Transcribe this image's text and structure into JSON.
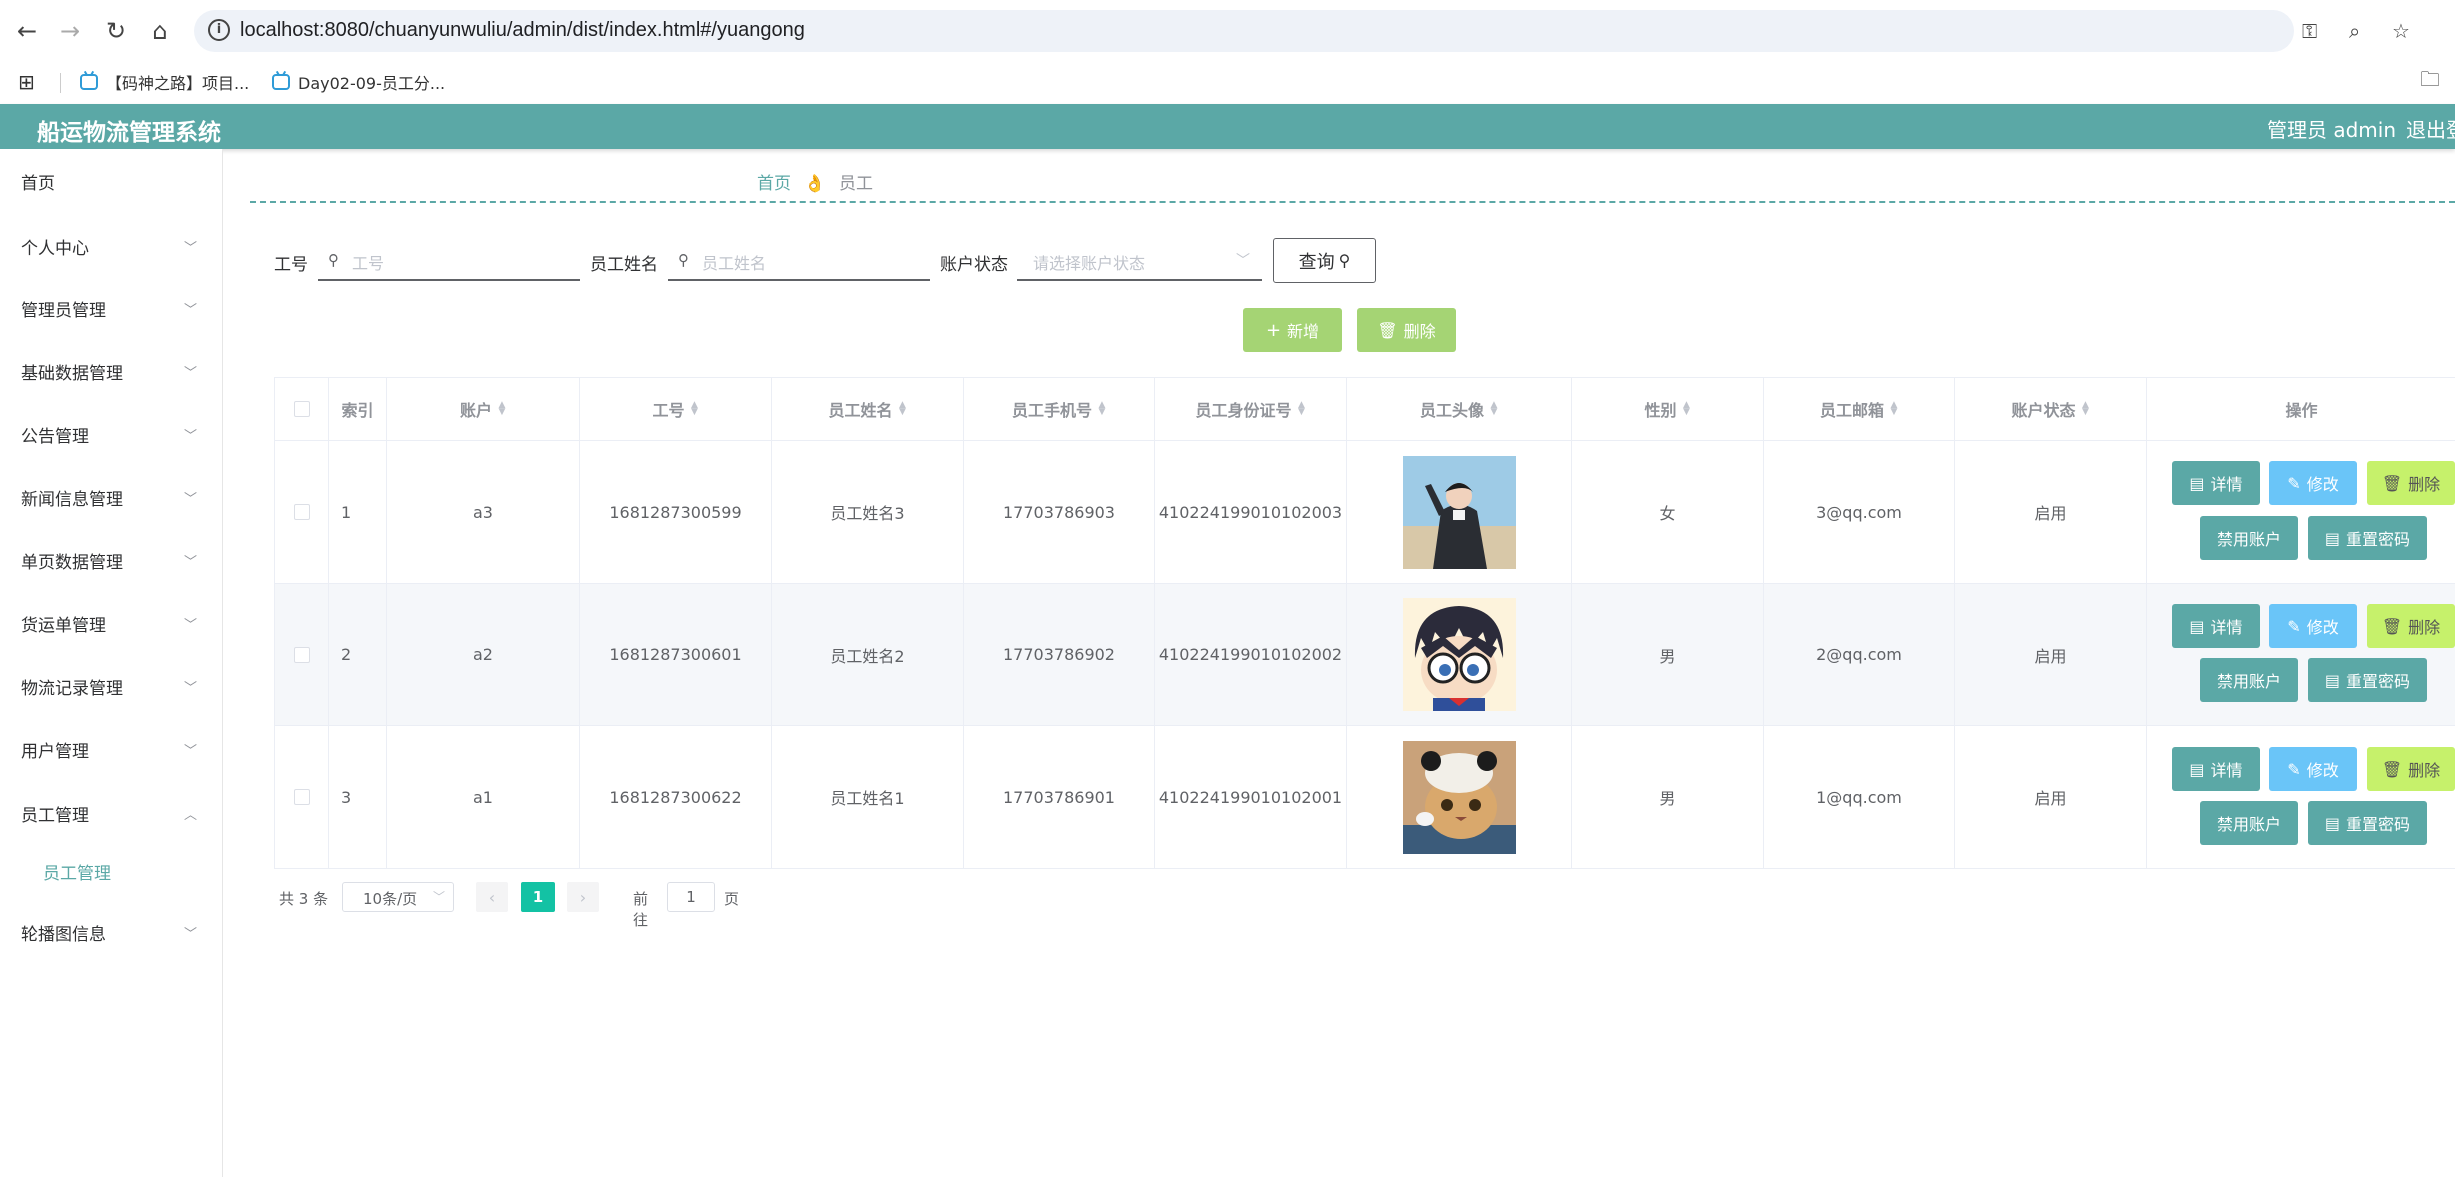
{
  "browser": {
    "url": "localhost:8080/chuanyunwuliu/admin/dist/index.html#/yuangong",
    "bookmarks": [
      "【码神之路】项目...",
      "Day02-09-员工分..."
    ]
  },
  "header": {
    "title": "船运物流管理系统",
    "admin": "管理员 admin",
    "logout": "退出登"
  },
  "sidebar": {
    "items": [
      {
        "label": "首页"
      },
      {
        "label": "个人中心"
      },
      {
        "label": "管理员管理"
      },
      {
        "label": "基础数据管理"
      },
      {
        "label": "公告管理"
      },
      {
        "label": "新闻信息管理"
      },
      {
        "label": "单页数据管理"
      },
      {
        "label": "货运单管理"
      },
      {
        "label": "物流记录管理"
      },
      {
        "label": "用户管理"
      },
      {
        "label": "员工管理"
      },
      {
        "label": "员工管理"
      },
      {
        "label": "轮播图信息"
      }
    ]
  },
  "breadcrumb": {
    "home": "首页",
    "sep": "👌",
    "current": "员工"
  },
  "search": {
    "gonghao_label": "工号",
    "gonghao_placeholder": "工号",
    "name_label": "员工姓名",
    "name_placeholder": "员工姓名",
    "status_label": "账户状态",
    "status_placeholder": "请选择账户状态",
    "query": "查询"
  },
  "actions": {
    "add": "新增",
    "delete": "删除"
  },
  "table": {
    "headers": [
      "索引",
      "账户",
      "工号",
      "员工姓名",
      "员工手机号",
      "员工身份证号",
      "员工头像",
      "性别",
      "员工邮箱",
      "账户状态",
      "操作"
    ],
    "rows": [
      {
        "index": "1",
        "account": "a3",
        "gonghao": "1681287300599",
        "name": "员工姓名3",
        "phone": "17703786903",
        "idcard": "410224199010102003",
        "gender": "女",
        "email": "3@qq.com",
        "status": "启用"
      },
      {
        "index": "2",
        "account": "a2",
        "gonghao": "1681287300601",
        "name": "员工姓名2",
        "phone": "17703786902",
        "idcard": "410224199010102002",
        "gender": "男",
        "email": "2@qq.com",
        "status": "启用"
      },
      {
        "index": "3",
        "account": "a1",
        "gonghao": "1681287300622",
        "name": "员工姓名1",
        "phone": "17703786901",
        "idcard": "410224199010102001",
        "gender": "男",
        "email": "1@qq.com",
        "status": "启用"
      }
    ],
    "ops": {
      "detail": "详情",
      "edit": "修改",
      "delete": "删除",
      "disable": "禁用账户",
      "reset": "重置密码"
    }
  },
  "pager": {
    "total": "共 3 条",
    "size": "10条/页",
    "current": "1",
    "goto_prefix": "前往",
    "goto_value": "1",
    "goto_suffix": "页"
  },
  "colors": {
    "primary": "#5ba8a6",
    "green": "#a5d474",
    "blue": "#6ac5f8",
    "lime": "#c6f16b",
    "page_active": "#13c2a4"
  }
}
